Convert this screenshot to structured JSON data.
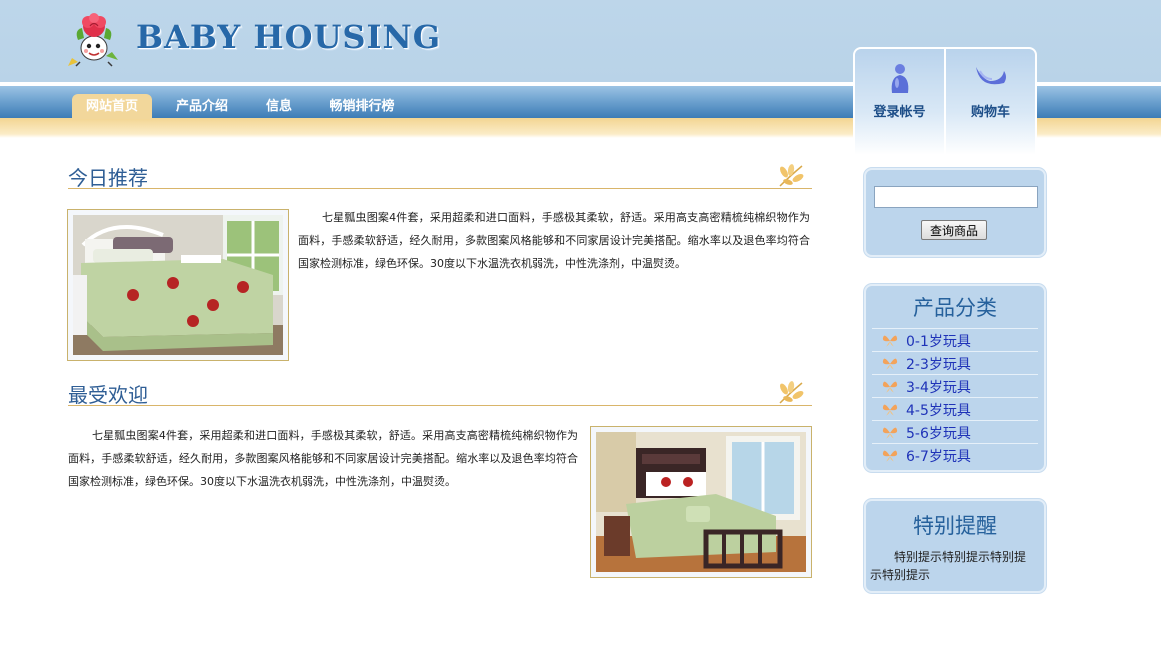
{
  "site": {
    "logo_text": "BABY HOUSING"
  },
  "nav": {
    "items": [
      {
        "label": "网站首页",
        "active": true
      },
      {
        "label": "产品介绍",
        "active": false
      },
      {
        "label": "信息",
        "active": false
      },
      {
        "label": "畅销排行榜",
        "active": false
      }
    ]
  },
  "user_panel": {
    "login_label": "登录帐号",
    "cart_label": "购物车"
  },
  "sections": {
    "today": {
      "title": "今日推荐",
      "text": "七星瓢虫图案4件套，采用超柔和进口面料，手感极其柔软，舒适。采用高支高密精梳纯棉织物作为面料，手感柔软舒适，经久耐用，多款图案风格能够和不同家居设计完美搭配。缩水率以及退色率均符合国家检测标准，绿色环保。30度以下水温洗衣机弱洗，中性洗涤剂，中温熨烫。"
    },
    "popular": {
      "title": "最受欢迎",
      "text": "七星瓢虫图案4件套，采用超柔和进口面料，手感极其柔软，舒适。采用高支高密精梳纯棉织物作为面料，手感柔软舒适，经久耐用，多款图案风格能够和不同家居设计完美搭配。缩水率以及退色率均符合国家检测标准，绿色环保。30度以下水温洗衣机弱洗，中性洗涤剂，中温熨烫。"
    }
  },
  "search": {
    "value": "",
    "button_label": "查询商品"
  },
  "categories": {
    "title": "产品分类",
    "items": [
      "0-1岁玩具",
      "2-3岁玩具",
      "3-4岁玩具",
      "4-5岁玩具",
      "5-6岁玩具",
      "6-7岁玩具"
    ]
  },
  "notice": {
    "title": "特别提醒",
    "text": "特别提示特别提示特别提示特别提示"
  },
  "colors": {
    "header_blue": "#bdd6ea",
    "nav_blue": "#3d7cb6",
    "accent_gold": "#f2d79b",
    "title_blue": "#2f5e95",
    "link_blue": "#1f33b8"
  },
  "icons": {
    "login": "user-icon",
    "cart": "moon-cart-icon",
    "section": "leaf-ornament-icon",
    "category": "butterfly-icon"
  }
}
